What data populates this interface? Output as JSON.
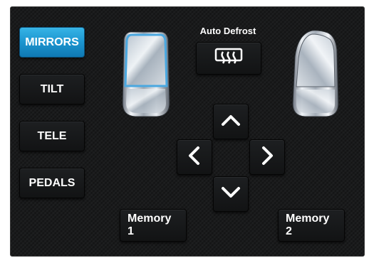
{
  "side_menu": {
    "items": [
      {
        "label": "MIRRORS",
        "active": true
      },
      {
        "label": "TILT",
        "active": false
      },
      {
        "label": "TELE",
        "active": false
      },
      {
        "label": "PEDALS",
        "active": false
      }
    ]
  },
  "defrost": {
    "label": "Auto Defrost",
    "icon": "rear-defrost-icon"
  },
  "mirrors": {
    "left": {
      "selected": true
    },
    "right": {
      "selected": false
    }
  },
  "arrows": [
    "up-arrow-icon",
    "left-arrow-icon",
    "right-arrow-icon",
    "down-arrow-icon"
  ],
  "memory": {
    "button1": "Memory 1",
    "button2": "Memory 2"
  },
  "colors": {
    "accent": "#1c95cf",
    "selection_outline": "#4aa8e0",
    "background": "#1a1b1c"
  }
}
